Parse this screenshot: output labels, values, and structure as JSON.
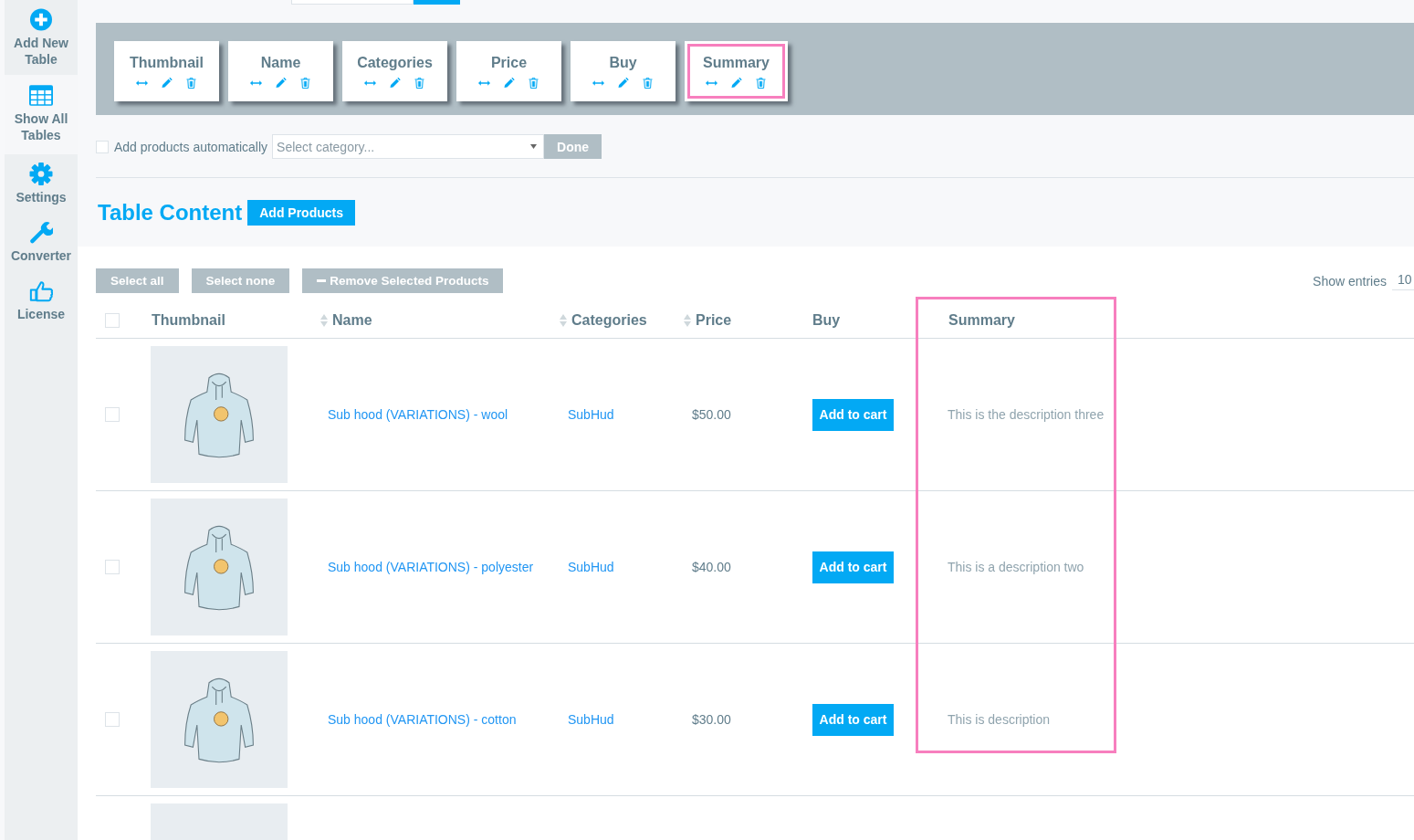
{
  "sidebar": {
    "items": [
      {
        "label": "Add New Table",
        "selected": false
      },
      {
        "label": "Show All Tables",
        "selected": true
      },
      {
        "label": "Settings",
        "selected": false
      },
      {
        "label": "Converter",
        "selected": false
      },
      {
        "label": "License",
        "selected": false
      }
    ]
  },
  "column_cards": [
    {
      "label": "Thumbnail",
      "highlighted": false
    },
    {
      "label": "Name",
      "highlighted": false
    },
    {
      "label": "Categories",
      "highlighted": false
    },
    {
      "label": "Price",
      "highlighted": false
    },
    {
      "label": "Buy",
      "highlighted": false
    },
    {
      "label": "Summary",
      "highlighted": true
    }
  ],
  "auto_add": {
    "label": "Add products automatically",
    "checked": false,
    "placeholder": "Select category...",
    "button": "Done"
  },
  "content": {
    "title": "Table Content",
    "add_button": "Add Products"
  },
  "toolbar": {
    "buttons": [
      {
        "label": "Select all",
        "kind": "plain"
      },
      {
        "label": "Select none",
        "kind": "plain"
      },
      {
        "label": "Remove Selected Products",
        "kind": "remove"
      }
    ],
    "show_entries": {
      "label": "Show entries",
      "value": "10"
    }
  },
  "table": {
    "select_all_checked": false,
    "columns": [
      {
        "label": "Thumbnail",
        "sortable": false,
        "highlighted": false
      },
      {
        "label": "Name",
        "sortable": true,
        "highlighted": false
      },
      {
        "label": "Categories",
        "sortable": true,
        "highlighted": false
      },
      {
        "label": "Price",
        "sortable": true,
        "highlighted": false
      },
      {
        "label": "Buy",
        "sortable": false,
        "highlighted": false
      },
      {
        "label": "Summary",
        "sortable": false,
        "highlighted": true
      }
    ],
    "rows": [
      {
        "checked": false,
        "name": "Sub hood (VARIATIONS) - wool",
        "category": "SubHud",
        "price": "$50.00",
        "button": "Add to cart",
        "summary": "This is the description three"
      },
      {
        "checked": false,
        "name": "Sub hood (VARIATIONS) - polyester",
        "category": "SubHud",
        "price": "$40.00",
        "button": "Add to cart",
        "summary": "This is a description two"
      },
      {
        "checked": false,
        "name": "Sub hood (VARIATIONS) - cotton",
        "category": "SubHud",
        "price": "$30.00",
        "button": "Add to cart",
        "summary": "This is description"
      }
    ]
  }
}
